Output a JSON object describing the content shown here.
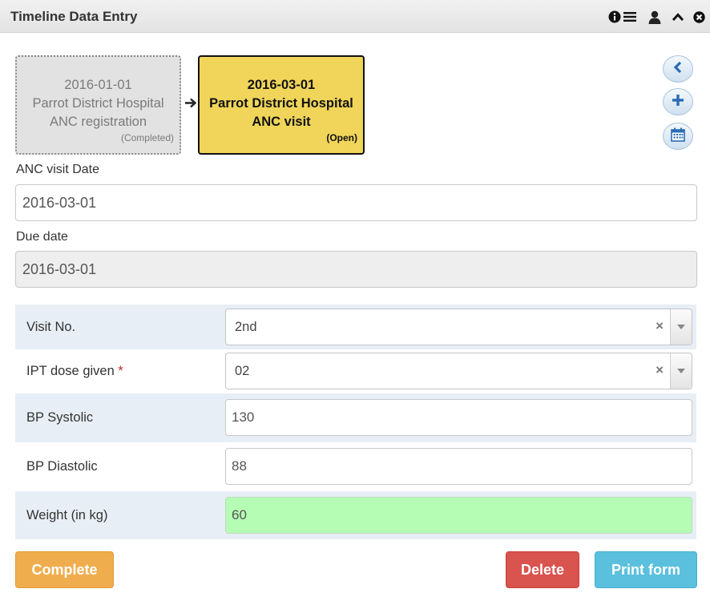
{
  "widget": {
    "title": "Timeline Data Entry",
    "header_icons": [
      "info-icon",
      "list-icon",
      "user-icon",
      "chevron-up-icon",
      "close-circle-icon"
    ]
  },
  "timeline": {
    "events": [
      {
        "date": "2016-01-01",
        "orgunit": "Parrot District Hospital",
        "stage": "ANC registration",
        "status": "(Completed)"
      },
      {
        "date": "2016-03-01",
        "orgunit": "Parrot District Hospital",
        "stage": "ANC visit",
        "status": "(Open)"
      }
    ],
    "side_icons": [
      "chevron-left-icon",
      "plus-icon",
      "calendar-icon"
    ]
  },
  "dates": {
    "event_date_label": "ANC visit Date",
    "event_date_value": "2016-03-01",
    "due_date_label": "Due date",
    "due_date_value": "2016-03-01"
  },
  "form": {
    "visit_no": {
      "label": "Visit No.",
      "value": "2nd",
      "clear": "×"
    },
    "ipt_dose": {
      "label": "IPT dose given",
      "required_mark": "*",
      "value": "02",
      "clear": "×"
    },
    "bp_systolic": {
      "label": "BP Systolic",
      "value": "130"
    },
    "bp_diastolic": {
      "label": "BP Diastolic",
      "value": "88"
    },
    "weight": {
      "label": "Weight (in kg)",
      "value": "60"
    }
  },
  "actions": {
    "complete": "Complete",
    "delete": "Delete",
    "print": "Print form"
  },
  "colors": {
    "open_event": "#f0d55a",
    "completed_event": "#e2e2e2",
    "valid_field": "#b5fdb5",
    "complete_btn": "#f0ad4e",
    "delete_btn": "#d9534f",
    "print_btn": "#5bc0de"
  }
}
